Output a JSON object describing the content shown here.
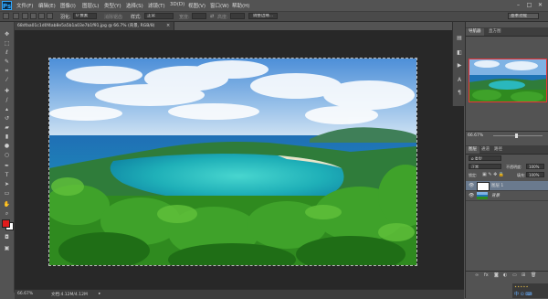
{
  "app": {
    "logo": "Ps"
  },
  "menu": [
    "文件(F)",
    "编辑(E)",
    "图像(I)",
    "图层(L)",
    "类型(Y)",
    "选择(S)",
    "滤镜(T)",
    "3D(D)",
    "视图(V)",
    "窗口(W)",
    "帮助(H)"
  ],
  "window_controls": {
    "minimize": "–",
    "restore": "□",
    "close": "✕"
  },
  "options": {
    "feather_label": "羽化:",
    "feather_value": "0 像素",
    "antialias_label": "消除锯齿",
    "style_label": "样式:",
    "style_value": "正常",
    "width_label": "宽度:",
    "height_label": "高度:",
    "refine_edge": "调整边缘...",
    "workspace": "基本功能"
  },
  "document": {
    "tab_title": "68dfaa01c1d0f4ab8e5a5b1a03e7b1f91.jpg @ 66.7% (背景, RGB/8)",
    "zoom": "66.67%",
    "doc_size": "文档:4.12M/4.12M"
  },
  "navigator": {
    "tabs": [
      "导航器",
      "直方图"
    ],
    "zoom": "66.67%"
  },
  "layers": {
    "tabs": [
      "图层",
      "通道",
      "路径"
    ],
    "blend_mode": "正常",
    "opacity_label": "不透明度:",
    "opacity_value": "100%",
    "lock_label": "锁定:",
    "fill_label": "填充:",
    "fill_value": "100%",
    "items": [
      {
        "name": "图层 1",
        "selected": true
      },
      {
        "name": "背景",
        "selected": false
      }
    ]
  },
  "colors": {
    "foreground": "#e01b1b",
    "background": "#ffffff"
  },
  "icons": [
    "move-icon",
    "marquee-icon",
    "lasso-icon",
    "quick-select-icon",
    "crop-icon",
    "eyedropper-icon",
    "heal-icon",
    "brush-icon",
    "stamp-icon",
    "history-brush-icon",
    "eraser-icon",
    "gradient-icon",
    "blur-icon",
    "dodge-icon",
    "pen-icon",
    "type-icon",
    "path-select-icon",
    "shape-icon",
    "hand-icon",
    "zoom-icon"
  ]
}
